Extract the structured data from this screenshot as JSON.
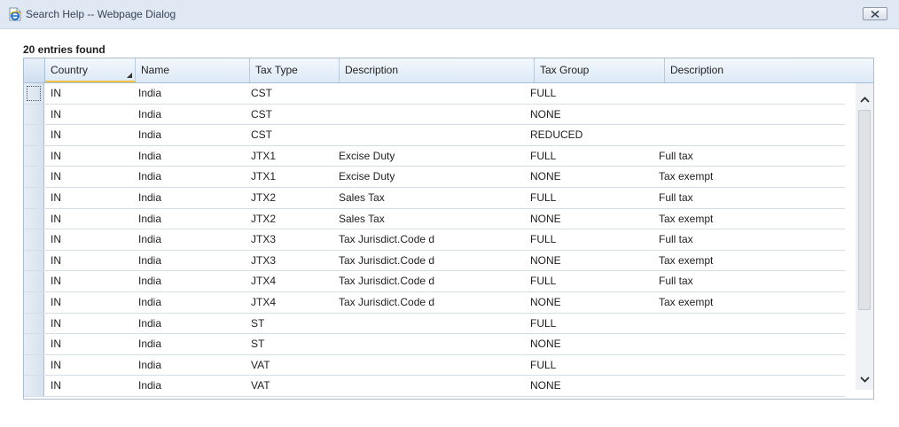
{
  "window": {
    "title": "Search Help -- Webpage Dialog",
    "icon": "ie-page-icon",
    "close_icon": "close-icon"
  },
  "results": {
    "count_label": "20 entries found"
  },
  "grid": {
    "columns": [
      {
        "key": "country",
        "label": "Country"
      },
      {
        "key": "name",
        "label": "Name"
      },
      {
        "key": "tax_type",
        "label": "Tax Type"
      },
      {
        "key": "description",
        "label": "Description"
      },
      {
        "key": "tax_group",
        "label": "Tax Group"
      },
      {
        "key": "group_description",
        "label": "Description"
      }
    ],
    "rows": [
      {
        "country": "IN",
        "name": "India",
        "tax_type": "CST",
        "description": "",
        "tax_group": "FULL",
        "group_description": ""
      },
      {
        "country": "IN",
        "name": "India",
        "tax_type": "CST",
        "description": "",
        "tax_group": "NONE",
        "group_description": ""
      },
      {
        "country": "IN",
        "name": "India",
        "tax_type": "CST",
        "description": "",
        "tax_group": "REDUCED",
        "group_description": ""
      },
      {
        "country": "IN",
        "name": "India",
        "tax_type": "JTX1",
        "description": "Excise Duty",
        "tax_group": "FULL",
        "group_description": "Full tax"
      },
      {
        "country": "IN",
        "name": "India",
        "tax_type": "JTX1",
        "description": "Excise Duty",
        "tax_group": "NONE",
        "group_description": "Tax exempt"
      },
      {
        "country": "IN",
        "name": "India",
        "tax_type": "JTX2",
        "description": "Sales Tax",
        "tax_group": "FULL",
        "group_description": "Full tax"
      },
      {
        "country": "IN",
        "name": "India",
        "tax_type": "JTX2",
        "description": "Sales Tax",
        "tax_group": "NONE",
        "group_description": "Tax exempt"
      },
      {
        "country": "IN",
        "name": "India",
        "tax_type": "JTX3",
        "description": "Tax Jurisdict.Code d",
        "tax_group": "FULL",
        "group_description": "Full tax"
      },
      {
        "country": "IN",
        "name": "India",
        "tax_type": "JTX3",
        "description": "Tax Jurisdict.Code d",
        "tax_group": "NONE",
        "group_description": "Tax exempt"
      },
      {
        "country": "IN",
        "name": "India",
        "tax_type": "JTX4",
        "description": "Tax Jurisdict.Code d",
        "tax_group": "FULL",
        "group_description": "Full tax"
      },
      {
        "country": "IN",
        "name": "India",
        "tax_type": "JTX4",
        "description": "Tax Jurisdict.Code d",
        "tax_group": "NONE",
        "group_description": "Tax exempt"
      },
      {
        "country": "IN",
        "name": "India",
        "tax_type": "ST",
        "description": "",
        "tax_group": "FULL",
        "group_description": ""
      },
      {
        "country": "IN",
        "name": "India",
        "tax_type": "ST",
        "description": "",
        "tax_group": "NONE",
        "group_description": ""
      },
      {
        "country": "IN",
        "name": "India",
        "tax_type": "VAT",
        "description": "",
        "tax_group": "FULL",
        "group_description": ""
      },
      {
        "country": "IN",
        "name": "India",
        "tax_type": "VAT",
        "description": "",
        "tax_group": "NONE",
        "group_description": ""
      }
    ]
  },
  "scrollbar": {
    "up_icon": "chevron-up-icon",
    "down_icon": "chevron-down-icon"
  }
}
